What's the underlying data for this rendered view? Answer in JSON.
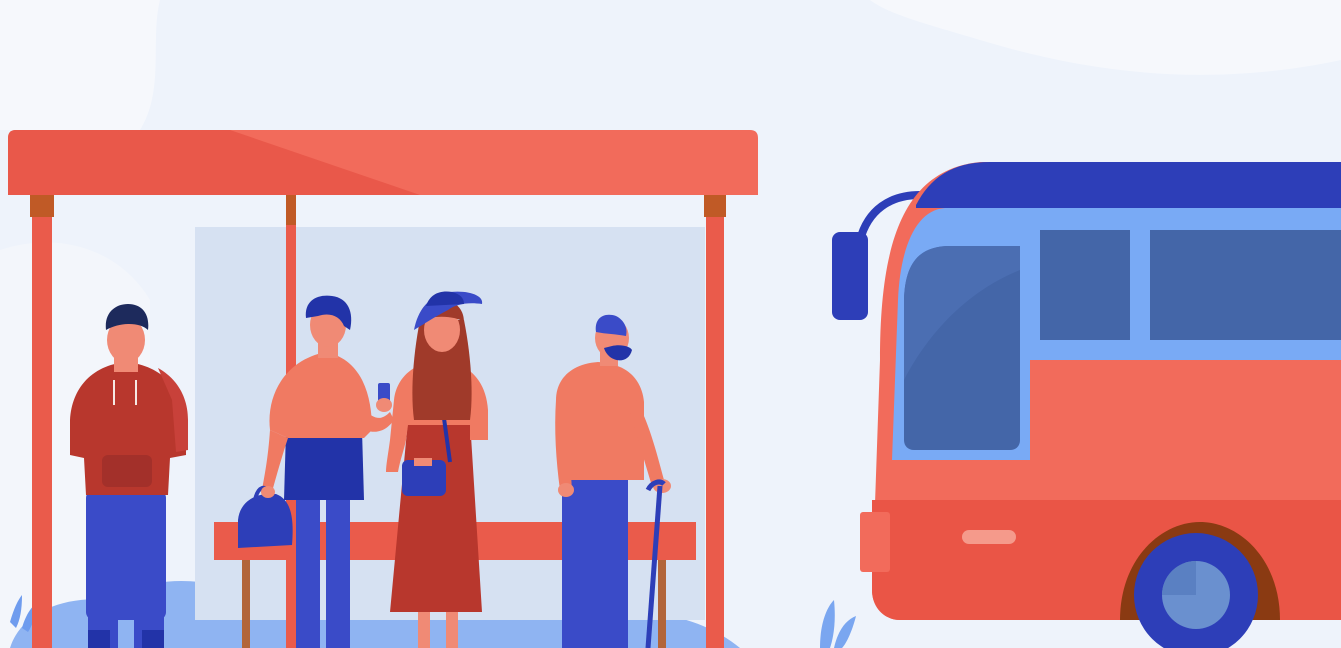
{
  "scene": {
    "description_name": "bus-stop-illustration",
    "colors": {
      "background": "#ffffff",
      "sky": "#eef3fb",
      "cloud": "#f6f8fc",
      "shelter_roof": "#f26b5b",
      "shelter_roof_dark": "#e9584a",
      "shelter_post": "#ea5b4b",
      "shelter_post_cap": "#c05a26",
      "glass": "#d6e1f2",
      "bench": "#ea5b4b",
      "bench_leg": "#b2653a",
      "ground_splash": "#8fb4f2",
      "bus_body": "#f26b5b",
      "bus_lower": "#ea5546",
      "bus_roof": "#2d3eb8",
      "bus_window_frame": "#79aaf5",
      "bus_window": "#4466a8",
      "wheel_outer": "#8a3a12",
      "wheel_tire": "#2d3eb8",
      "wheel_hub": "#6a90cf",
      "skin": "#f08a75",
      "hair_dark": "#1d2a5c",
      "hair_brown": "#a03a2a",
      "clothing_red": "#b8372d",
      "clothing_coral": "#f07a62",
      "clothing_blue": "#3a4bc8",
      "clothing_navy": "#2233a8"
    },
    "people_count": 4
  }
}
